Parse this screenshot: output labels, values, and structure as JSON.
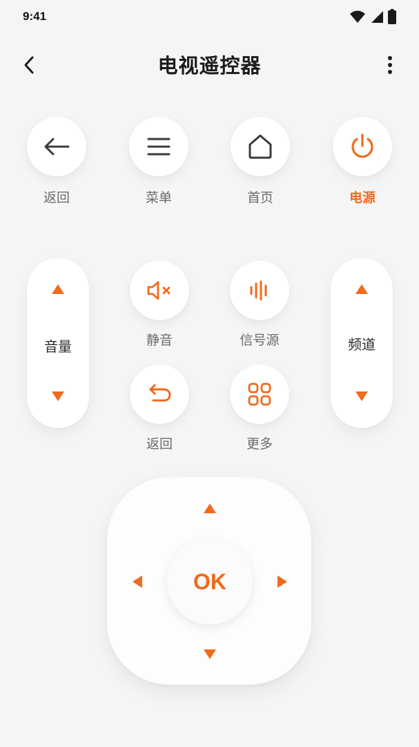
{
  "status_bar": {
    "time": "9:41"
  },
  "header": {
    "title": "电视遥控器"
  },
  "top_buttons": [
    {
      "label": "返回",
      "icon": "arrow-left-icon"
    },
    {
      "label": "菜单",
      "icon": "menu-icon"
    },
    {
      "label": "首页",
      "icon": "home-icon"
    },
    {
      "label": "电源",
      "icon": "power-icon"
    }
  ],
  "volume": {
    "label": "音量"
  },
  "channel": {
    "label": "频道"
  },
  "mid_buttons": [
    {
      "label": "静音",
      "icon": "mute-icon"
    },
    {
      "label": "信号源",
      "icon": "signal-source-icon"
    },
    {
      "label": "返回",
      "icon": "undo-return-icon"
    },
    {
      "label": "更多",
      "icon": "grid-more-icon"
    }
  ],
  "dpad": {
    "ok_label": "OK"
  },
  "colors": {
    "accent": "#f26a1b",
    "background": "#f5f5f5",
    "icon_dark": "#333333"
  }
}
